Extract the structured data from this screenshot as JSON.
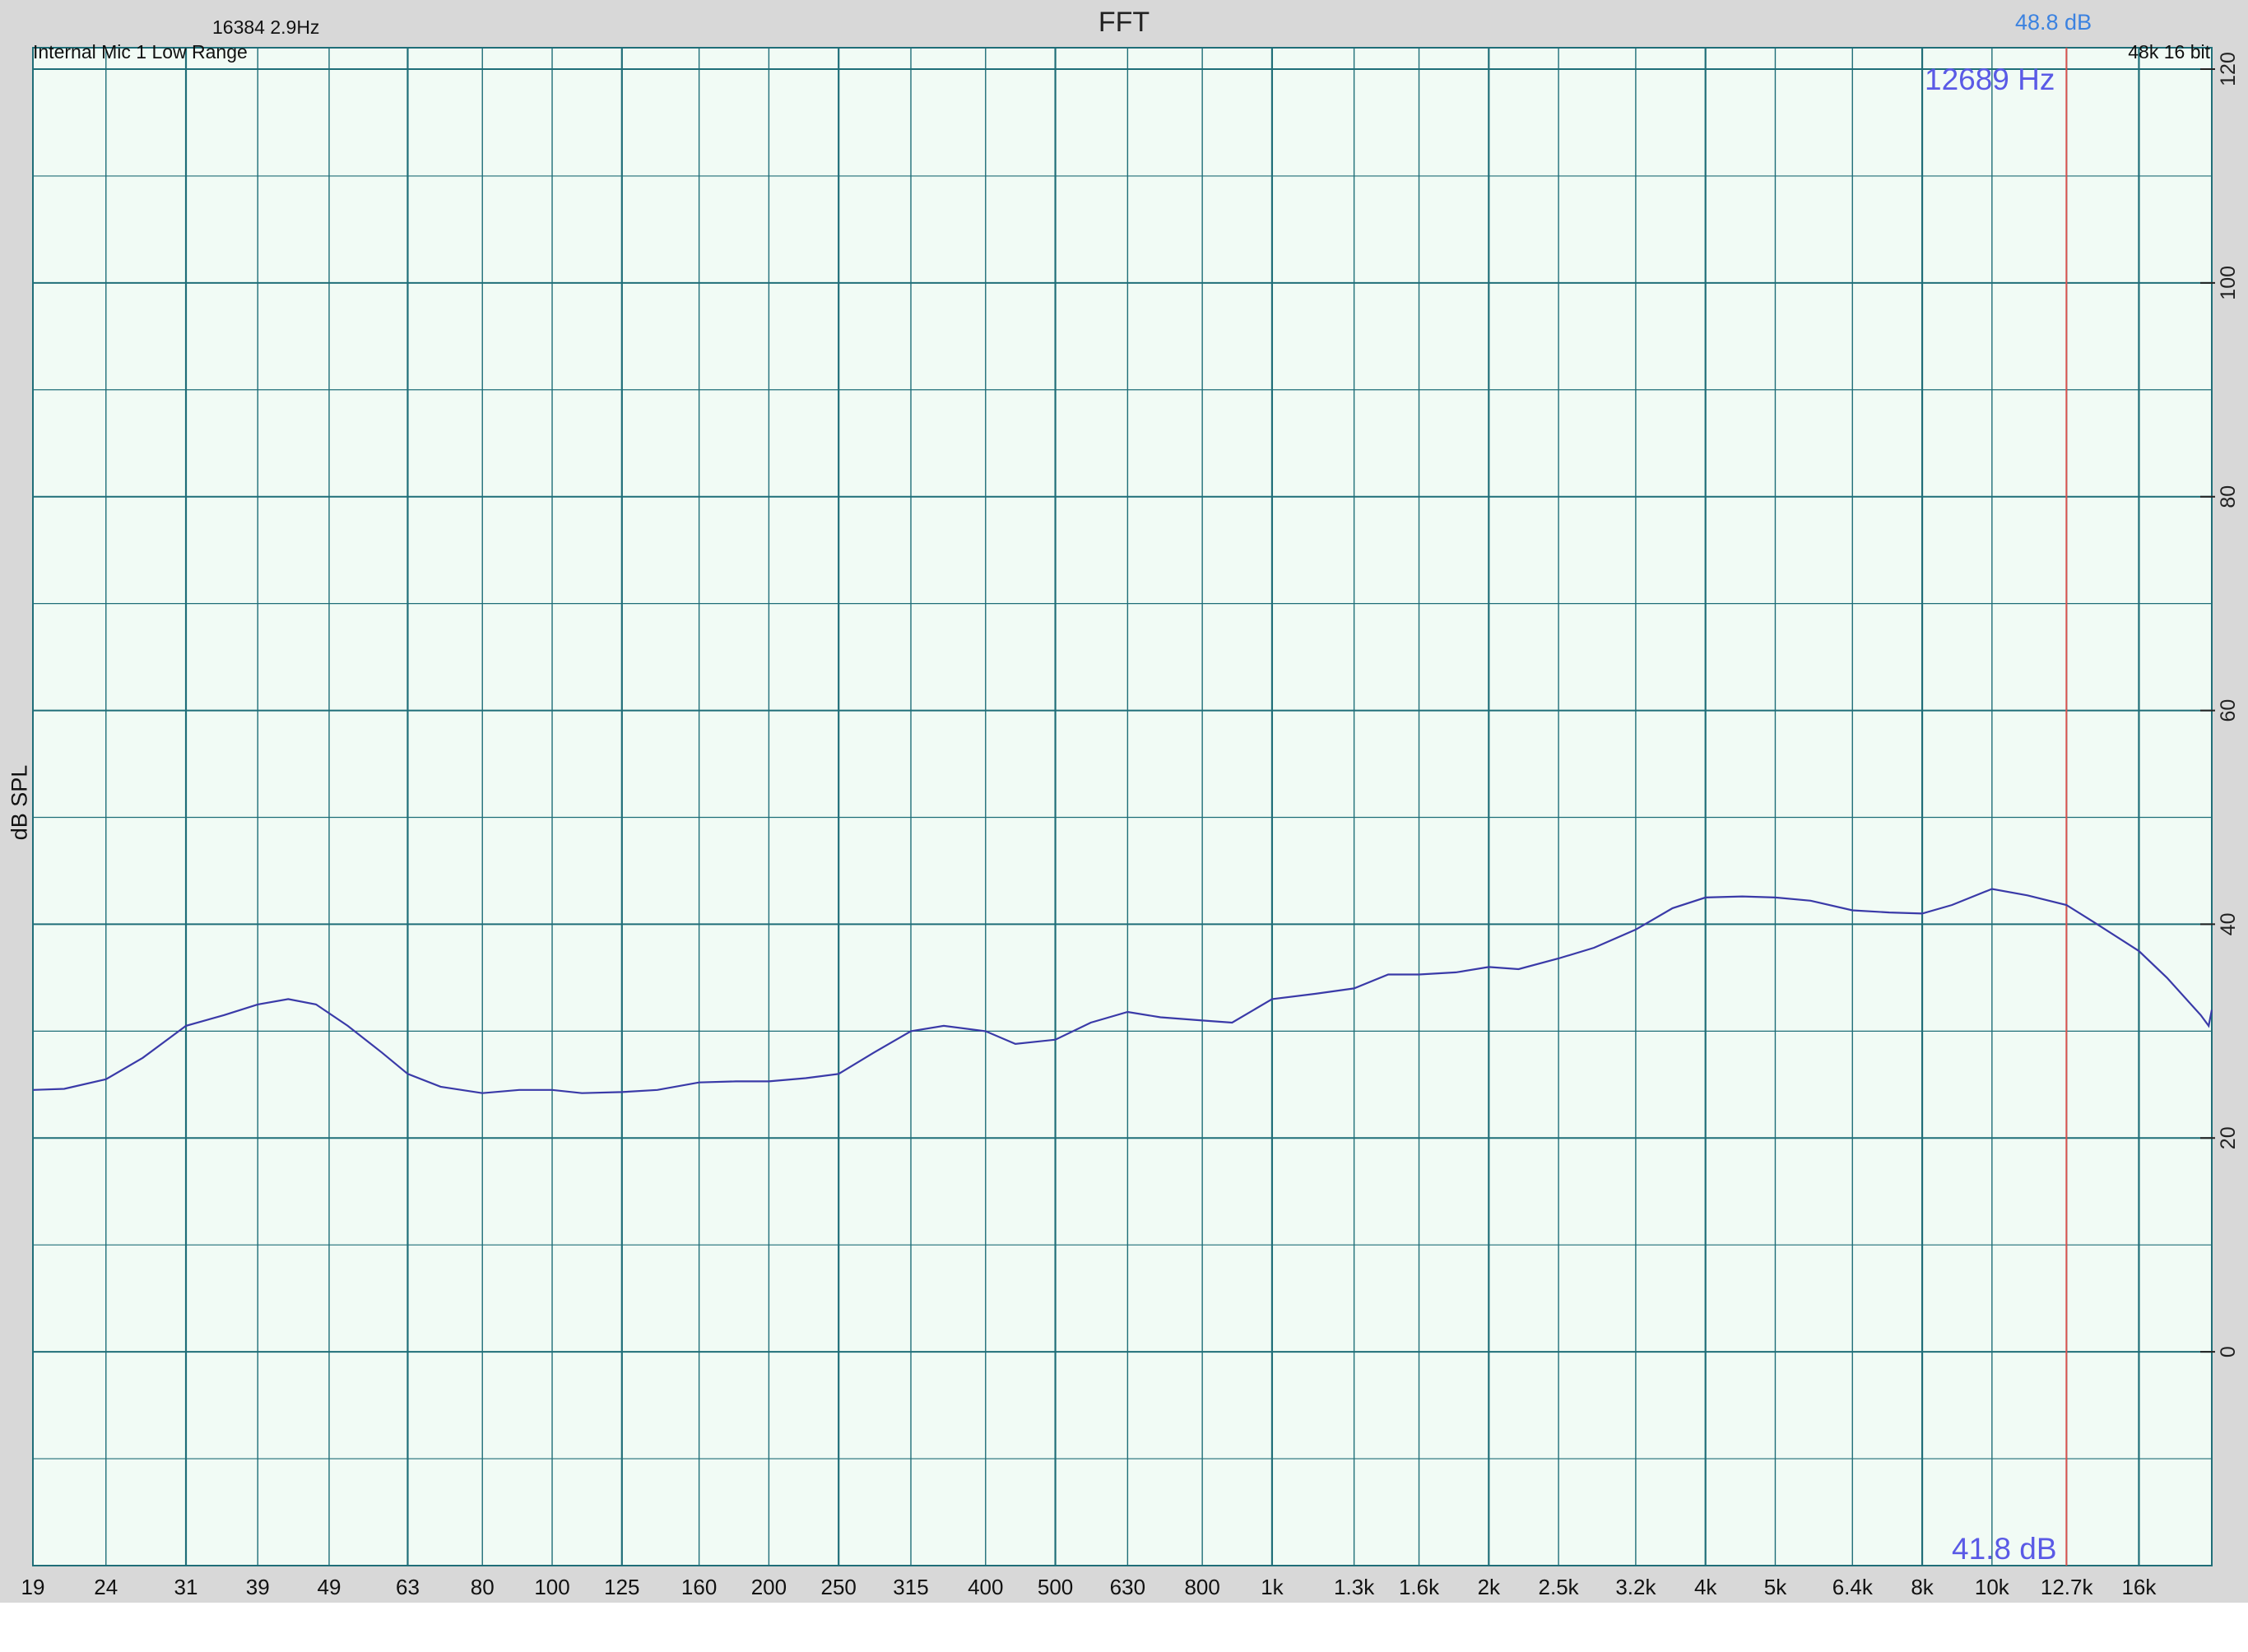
{
  "chart_data": {
    "type": "line",
    "title": "FFT",
    "ylabel": "dB SPL",
    "xscale": "log",
    "ylim": [
      -20,
      122
    ],
    "y_ticks": [
      0,
      20,
      40,
      60,
      80,
      100,
      120
    ],
    "x_ticks": [
      {
        "f": 19,
        "label": "19"
      },
      {
        "f": 24,
        "label": "24"
      },
      {
        "f": 31,
        "label": "31"
      },
      {
        "f": 39,
        "label": "39"
      },
      {
        "f": 49,
        "label": "49"
      },
      {
        "f": 63,
        "label": "63"
      },
      {
        "f": 80,
        "label": "80"
      },
      {
        "f": 100,
        "label": "100"
      },
      {
        "f": 125,
        "label": "125"
      },
      {
        "f": 160,
        "label": "160"
      },
      {
        "f": 200,
        "label": "200"
      },
      {
        "f": 250,
        "label": "250"
      },
      {
        "f": 315,
        "label": "315"
      },
      {
        "f": 400,
        "label": "400"
      },
      {
        "f": 500,
        "label": "500"
      },
      {
        "f": 630,
        "label": "630"
      },
      {
        "f": 800,
        "label": "800"
      },
      {
        "f": 1000,
        "label": "1k"
      },
      {
        "f": 1300,
        "label": "1.3k"
      },
      {
        "f": 1600,
        "label": "1.6k"
      },
      {
        "f": 2000,
        "label": "2k"
      },
      {
        "f": 2500,
        "label": "2.5k"
      },
      {
        "f": 3200,
        "label": "3.2k"
      },
      {
        "f": 4000,
        "label": "4k"
      },
      {
        "f": 5000,
        "label": "5k"
      },
      {
        "f": 6400,
        "label": "6.4k"
      },
      {
        "f": 8000,
        "label": "8k"
      },
      {
        "f": 10000,
        "label": "10k"
      },
      {
        "f": 12700,
        "label": "12.7k"
      },
      {
        "f": 16000,
        "label": "16k"
      }
    ],
    "series": [
      {
        "color": "#3a3aa8",
        "points": [
          [
            19,
            24.5
          ],
          [
            21,
            24.6
          ],
          [
            24,
            25.5
          ],
          [
            27,
            27.5
          ],
          [
            31,
            30.5
          ],
          [
            35,
            31.5
          ],
          [
            39,
            32.5
          ],
          [
            43,
            33
          ],
          [
            47,
            32.5
          ],
          [
            52,
            30.5
          ],
          [
            58,
            28
          ],
          [
            63,
            26
          ],
          [
            70,
            24.8
          ],
          [
            80,
            24.2
          ],
          [
            90,
            24.5
          ],
          [
            100,
            24.5
          ],
          [
            110,
            24.2
          ],
          [
            125,
            24.3
          ],
          [
            140,
            24.5
          ],
          [
            160,
            25.2
          ],
          [
            180,
            25.3
          ],
          [
            200,
            25.3
          ],
          [
            225,
            25.6
          ],
          [
            250,
            26
          ],
          [
            280,
            28
          ],
          [
            315,
            30
          ],
          [
            350,
            30.5
          ],
          [
            400,
            30
          ],
          [
            440,
            28.8
          ],
          [
            500,
            29.2
          ],
          [
            560,
            30.8
          ],
          [
            630,
            31.8
          ],
          [
            700,
            31.3
          ],
          [
            800,
            31
          ],
          [
            880,
            30.8
          ],
          [
            1000,
            33
          ],
          [
            1150,
            33.5
          ],
          [
            1300,
            34
          ],
          [
            1450,
            35.3
          ],
          [
            1600,
            35.3
          ],
          [
            1800,
            35.5
          ],
          [
            2000,
            36
          ],
          [
            2200,
            35.8
          ],
          [
            2500,
            36.8
          ],
          [
            2800,
            37.8
          ],
          [
            3200,
            39.5
          ],
          [
            3600,
            41.5
          ],
          [
            4000,
            42.5
          ],
          [
            4500,
            42.6
          ],
          [
            5000,
            42.5
          ],
          [
            5600,
            42.2
          ],
          [
            6400,
            41.3
          ],
          [
            7200,
            41.1
          ],
          [
            8000,
            41
          ],
          [
            8800,
            41.8
          ],
          [
            10000,
            43.3
          ],
          [
            11200,
            42.7
          ],
          [
            12689,
            41.8
          ],
          [
            14000,
            40
          ],
          [
            16000,
            37.5
          ],
          [
            17500,
            35
          ],
          [
            19500,
            31.5
          ],
          [
            20000,
            30.5
          ],
          [
            20200,
            32
          ]
        ]
      }
    ],
    "cursor": {
      "freq": 12689,
      "color": "#d9534f"
    }
  },
  "header": {
    "fft_info": "16384  2.9Hz",
    "device": "Internal Mic 1 Low Range",
    "format": "48k 16 bit"
  },
  "cursor_readout": {
    "top_db": "48.8 dB",
    "freq": "12689 Hz",
    "bottom_db": "41.8 dB"
  },
  "colors": {
    "background": "#d8d8d8",
    "plot_background": "#f1fbf5",
    "grid": "#1f6e78"
  }
}
